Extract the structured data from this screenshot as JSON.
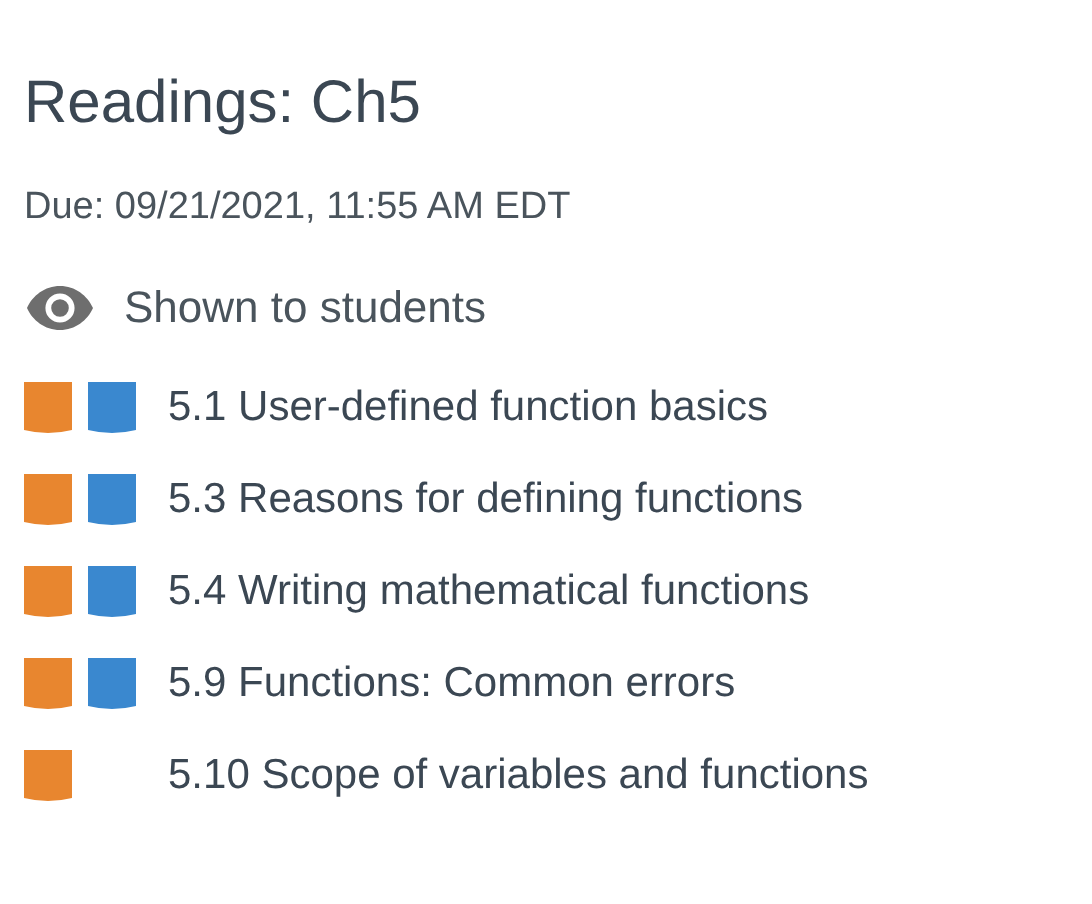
{
  "title": "Readings: Ch5",
  "due": "Due: 09/21/2021, 11:55 AM EDT",
  "visibility": {
    "label": "Shown to students"
  },
  "sections": [
    {
      "label": "5.1 User-defined function basics",
      "badges": [
        {
          "color": "#e8862f"
        },
        {
          "color": "#3a88cf"
        }
      ]
    },
    {
      "label": "5.3 Reasons for defining functions",
      "badges": [
        {
          "color": "#e8862f"
        },
        {
          "color": "#3a88cf"
        }
      ]
    },
    {
      "label": "5.4 Writing mathematical functions",
      "badges": [
        {
          "color": "#e8862f"
        },
        {
          "color": "#3a88cf"
        }
      ]
    },
    {
      "label": "5.9 Functions: Common errors",
      "badges": [
        {
          "color": "#e8862f"
        },
        {
          "color": "#3a88cf"
        }
      ]
    },
    {
      "label": "5.10 Scope of variables and functions",
      "badges": [
        {
          "color": "#e8862f"
        }
      ]
    }
  ]
}
